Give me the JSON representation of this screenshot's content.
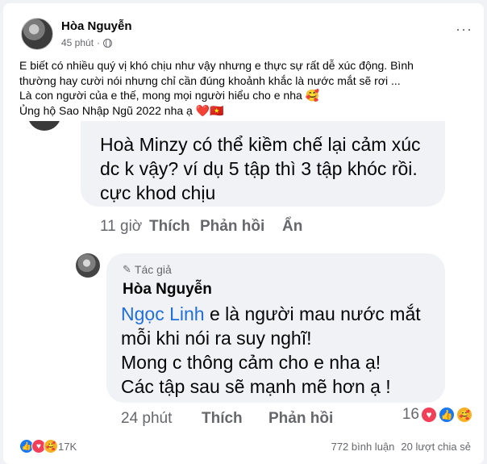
{
  "post": {
    "author": "Hòa Nguyễn",
    "time": "45 phút",
    "privacy_icon": "globe-icon",
    "more_label": "···",
    "text_lines": [
      "E biết có nhiều quý vị khó chịu như vậy nhưng e thực sự rất dễ xúc động. Bình",
      "thường hay cười nói nhưng chỉ cần đúng khoảnh khắc là nước mắt sẽ rơi ...",
      "Là con người của e thế, mong mọi người hiểu cho e nha 🥰",
      "Ủng hộ Sao Nhập Ngũ 2022 nha ạ"
    ],
    "emoji_heart": "❤️",
    "emoji_flag": "🇻🇳"
  },
  "screenshot": {
    "comment1": {
      "lines": [
        "Hoà Minzy có thể kiềm chế lại cảm xúc",
        "dc k vậy? ví dụ 5 tập thì 3 tập khóc rồi.",
        "cực khod chịu"
      ],
      "time": "11 giờ",
      "like": "Thích",
      "reply": "Phản hồi",
      "hide": "Ẩn"
    },
    "comment2": {
      "author_tag": "Tác giả",
      "author": "Hòa Nguyễn",
      "mention": "Ngọc Linh",
      "line1_rest": " e là người mau nước mắt",
      "lines": [
        "mỗi khi nói ra suy nghĩ!",
        "Mong c thông cảm cho e nha ạ!",
        "Các tập sau sẽ mạnh mẽ hơn ạ !"
      ],
      "time": "24 phút",
      "like": "Thích",
      "reply": "Phản hồi",
      "reaction_count": "16"
    }
  },
  "footer": {
    "reaction_count": "17K",
    "comments": "772 bình luận",
    "shares": "20 lượt chia sẻ"
  },
  "colors": {
    "mention": "#216fdb",
    "love": "#f33e58",
    "like": "#1877f2",
    "care": "#f7b125"
  }
}
